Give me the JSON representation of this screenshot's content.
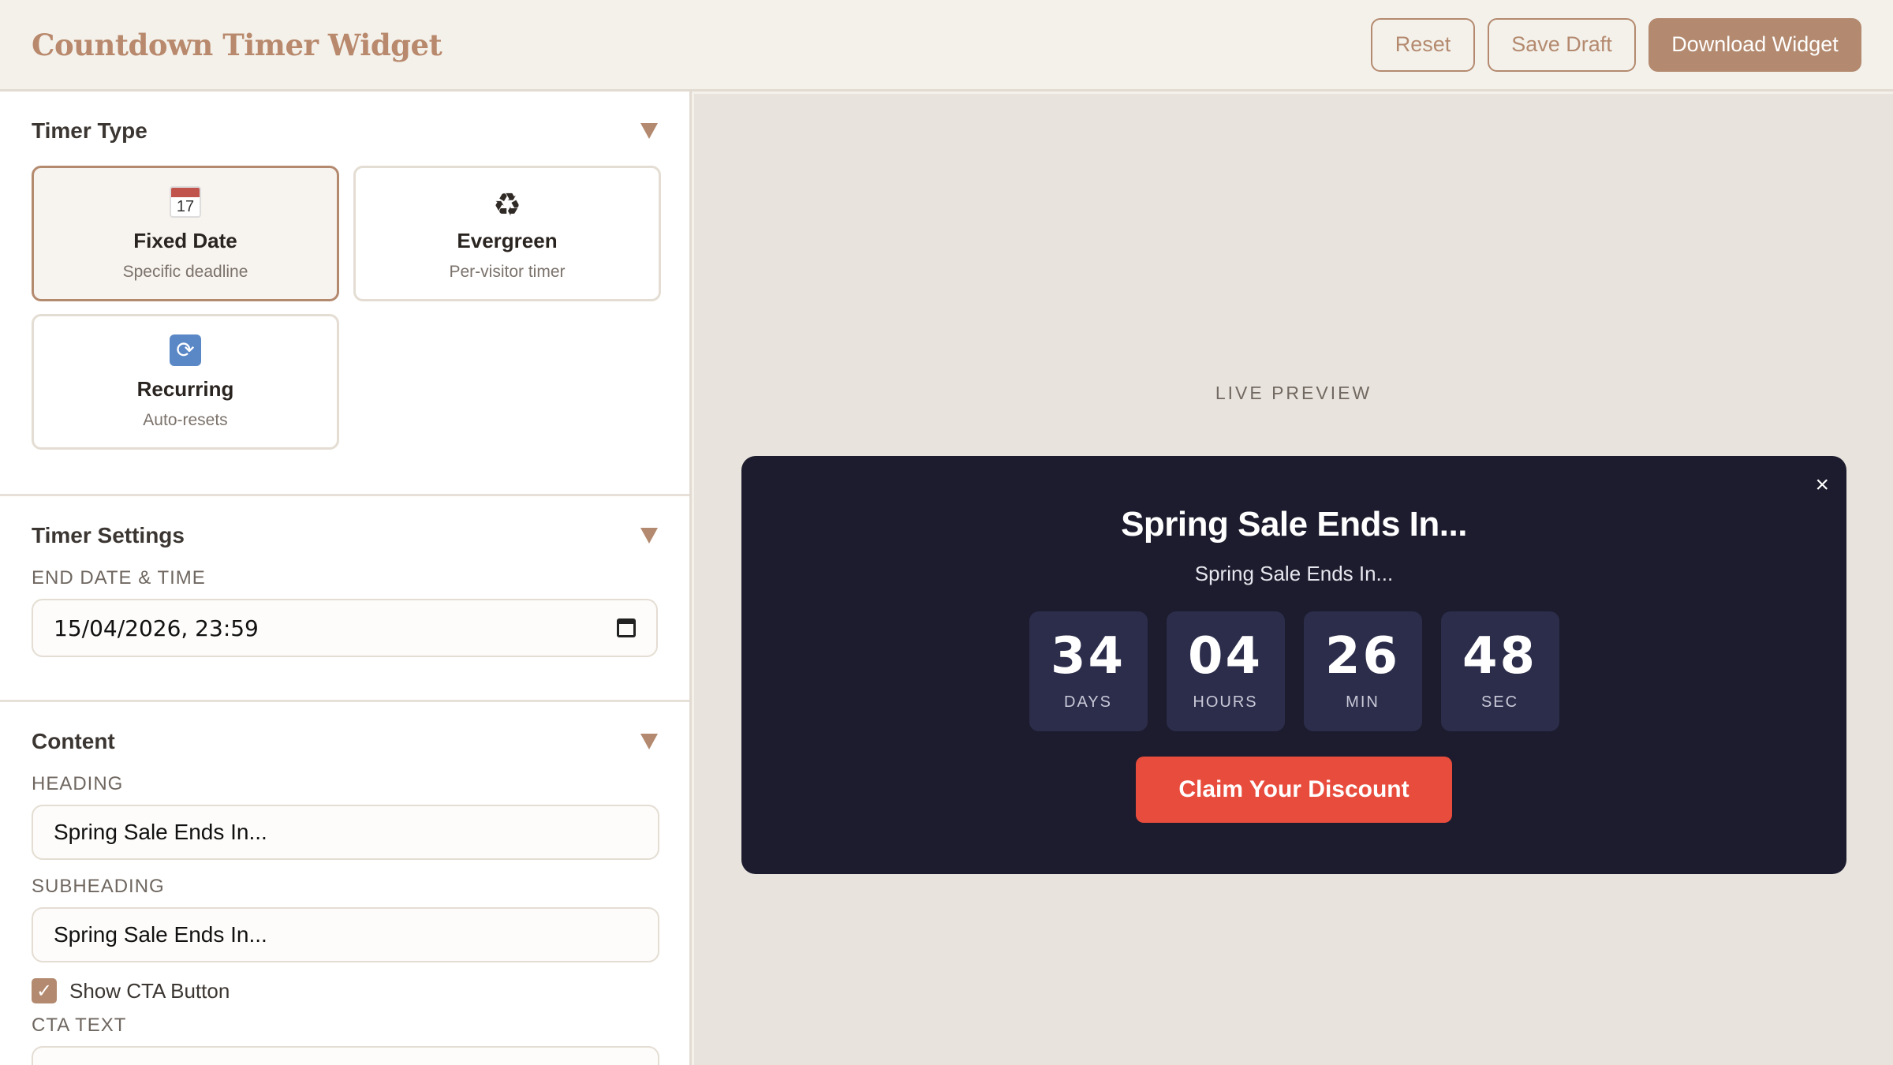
{
  "app": {
    "title": "Countdown Timer Widget"
  },
  "toolbar": {
    "reset_label": "Reset",
    "save_draft_label": "Save Draft",
    "download_label": "Download Widget"
  },
  "sections": {
    "timer_type": {
      "title": "Timer Type",
      "options": [
        {
          "name": "Fixed Date",
          "desc": "Specific deadline",
          "icon": "calendar-icon",
          "icon_text": "17",
          "selected": true
        },
        {
          "name": "Evergreen",
          "desc": "Per-visitor timer",
          "icon": "recycle-icon",
          "icon_text": "♻",
          "selected": false
        },
        {
          "name": "Recurring",
          "desc": "Auto-resets",
          "icon": "refresh-icon",
          "icon_text": "⟳",
          "selected": false
        }
      ]
    },
    "timer_settings": {
      "title": "Timer Settings",
      "end_label": "END DATE & TIME",
      "end_value": "15/04/2026, 23:59"
    },
    "content": {
      "title": "Content",
      "heading_label": "HEADING",
      "heading_value": "Spring Sale Ends In...",
      "subheading_label": "SUBHEADING",
      "subheading_value": "Spring Sale Ends In...",
      "show_cta_label": "Show CTA Button",
      "show_cta_checked": true,
      "cta_text_label": "CTA TEXT"
    }
  },
  "preview": {
    "label": "LIVE PREVIEW",
    "close_glyph": "×",
    "heading": "Spring Sale Ends In...",
    "subheading": "Spring Sale Ends In...",
    "countdown": [
      {
        "value": "34",
        "label": "DAYS"
      },
      {
        "value": "04",
        "label": "HOURS"
      },
      {
        "value": "26",
        "label": "MIN"
      },
      {
        "value": "48",
        "label": "SEC"
      }
    ],
    "cta_label": "Claim Your Discount"
  },
  "colors": {
    "accent": "#b38a6f",
    "widget_bg": "#1c1c2e",
    "cta": "#e84c3d"
  }
}
